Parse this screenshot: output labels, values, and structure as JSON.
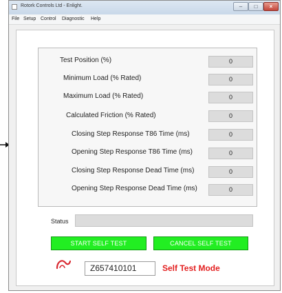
{
  "window": {
    "title": "Rotork Controls Ltd - Enlight.",
    "minimize_glyph": "–",
    "maximize_glyph": "□",
    "close_glyph": "×"
  },
  "menu": {
    "items": [
      "File",
      "Setup",
      "Control",
      "Diagnostic",
      "Help"
    ]
  },
  "results": {
    "rows": [
      {
        "label": "Test Position (%)",
        "value": "0"
      },
      {
        "label": "Minimum Load (% Rated)",
        "value": "0"
      },
      {
        "label": "Maximum Load (% Rated)",
        "value": "0"
      },
      {
        "label": "Calculated Friction (% Rated)",
        "value": "0"
      },
      {
        "label": "Closing Step Response T86 Time (ms)",
        "value": "0"
      },
      {
        "label": "Opening Step Response T86 Time (ms)",
        "value": "0"
      },
      {
        "label": "Closing Step Response Dead Time (ms)",
        "value": "0"
      },
      {
        "label": "Opening Step Response Dead Time (ms)",
        "value": "0"
      }
    ]
  },
  "status": {
    "label": "Status",
    "value": ""
  },
  "actions": {
    "start_label": "START SELF TEST",
    "cancel_label": "CANCEL SELF TEST"
  },
  "footer": {
    "serial": "Z657410101",
    "mode": "Self Test Mode",
    "logo_icon": "rotork-logo-icon"
  },
  "colors": {
    "button_green": "#22ee22",
    "mode_red": "#e32020",
    "field_gray": "#dcdcdc"
  }
}
